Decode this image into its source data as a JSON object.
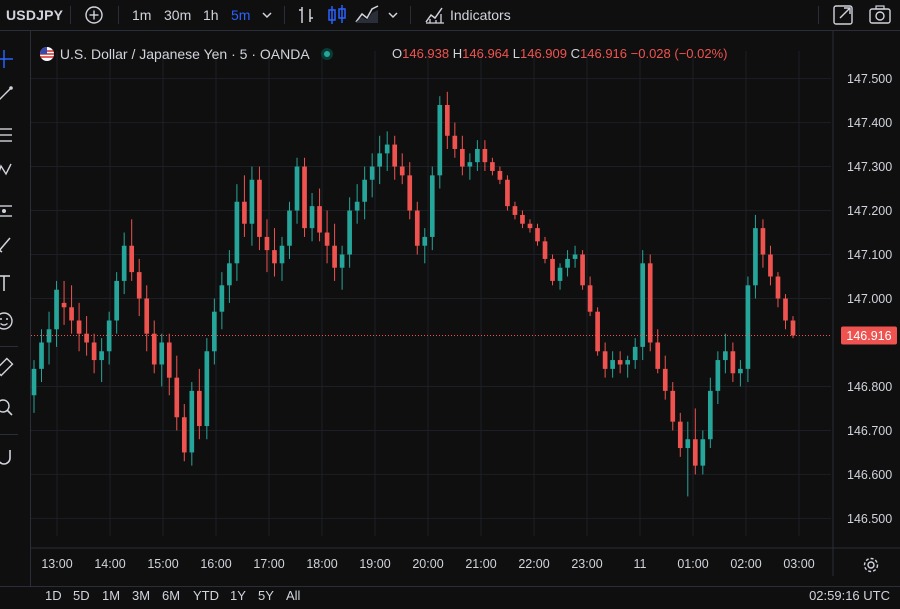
{
  "header": {
    "symbol": "USDJPY",
    "intervals": [
      "1m",
      "30m",
      "1h",
      "5m"
    ],
    "active_interval": "5m",
    "indicators_label": "Indicators"
  },
  "legend": {
    "pair": "U.S. Dollar / Japanese Yen · 5 · OANDA",
    "o_key": "O",
    "o_val": "146.938",
    "h_key": "H",
    "h_val": "146.964",
    "l_key": "L",
    "l_val": "146.909",
    "c_key": "C",
    "c_val": "146.916",
    "change": "−0.028 (−0.02%)"
  },
  "colors": {
    "up": "#26a69a",
    "down": "#ef5350",
    "background": "#0f0f0f",
    "active": "#2962ff"
  },
  "bottom": {
    "ranges": [
      "1D",
      "5D",
      "1M",
      "3M",
      "6M",
      "YTD",
      "1Y",
      "5Y",
      "All"
    ],
    "clock": "02:59:16 UTC"
  },
  "chart_data": {
    "type": "candlestick",
    "last_price": 146.916,
    "last_price_label": "146.916",
    "y_ticks": [
      "147.500",
      "147.400",
      "147.300",
      "147.200",
      "147.100",
      "147.000",
      "146.800",
      "146.700",
      "146.600",
      "146.500"
    ],
    "ylim": [
      146.46,
      147.54
    ],
    "x_ticks": [
      "13:00",
      "14:00",
      "15:00",
      "16:00",
      "17:00",
      "18:00",
      "19:00",
      "20:00",
      "21:00",
      "22:00",
      "23:00",
      "11",
      "01:00",
      "02:00",
      "03:00"
    ],
    "candles": [
      [
        146.78,
        146.86,
        146.74,
        146.84
      ],
      [
        146.84,
        146.93,
        146.81,
        146.9
      ],
      [
        146.9,
        146.97,
        146.85,
        146.93
      ],
      [
        146.93,
        147.04,
        146.89,
        147.02
      ],
      [
        146.99,
        147.04,
        146.94,
        146.98
      ],
      [
        146.98,
        147.03,
        146.92,
        146.95
      ],
      [
        146.95,
        146.99,
        146.88,
        146.92
      ],
      [
        146.92,
        146.96,
        146.87,
        146.9
      ],
      [
        146.9,
        146.92,
        146.83,
        146.86
      ],
      [
        146.86,
        146.91,
        146.81,
        146.88
      ],
      [
        146.88,
        146.97,
        146.85,
        146.95
      ],
      [
        146.95,
        147.06,
        146.92,
        147.04
      ],
      [
        147.04,
        147.15,
        147.01,
        147.12
      ],
      [
        147.12,
        147.18,
        147.04,
        147.06
      ],
      [
        147.06,
        147.09,
        146.96,
        147.0
      ],
      [
        147.0,
        147.03,
        146.88,
        146.92
      ],
      [
        146.92,
        146.95,
        146.83,
        146.85
      ],
      [
        146.85,
        146.92,
        146.8,
        146.9
      ],
      [
        146.9,
        146.92,
        146.78,
        146.82
      ],
      [
        146.82,
        146.87,
        146.7,
        146.73
      ],
      [
        146.73,
        146.76,
        146.63,
        146.65
      ],
      [
        146.65,
        146.81,
        146.62,
        146.79
      ],
      [
        146.79,
        146.84,
        146.68,
        146.71
      ],
      [
        146.71,
        146.91,
        146.68,
        146.88
      ],
      [
        146.88,
        147.0,
        146.85,
        146.97
      ],
      [
        146.97,
        147.06,
        146.93,
        147.03
      ],
      [
        147.03,
        147.11,
        146.99,
        147.08
      ],
      [
        147.08,
        147.26,
        147.04,
        147.22
      ],
      [
        147.22,
        147.28,
        147.14,
        147.17
      ],
      [
        147.17,
        147.3,
        147.12,
        147.27
      ],
      [
        147.27,
        147.3,
        147.11,
        147.14
      ],
      [
        147.14,
        147.18,
        147.06,
        147.11
      ],
      [
        147.11,
        147.16,
        147.05,
        147.08
      ],
      [
        147.08,
        147.14,
        147.04,
        147.12
      ],
      [
        147.12,
        147.22,
        147.09,
        147.2
      ],
      [
        147.2,
        147.32,
        147.17,
        147.3
      ],
      [
        147.3,
        147.32,
        147.14,
        147.16
      ],
      [
        147.16,
        147.24,
        147.13,
        147.21
      ],
      [
        147.21,
        147.25,
        147.13,
        147.15
      ],
      [
        147.15,
        147.2,
        147.08,
        147.12
      ],
      [
        147.12,
        147.17,
        147.04,
        147.07
      ],
      [
        147.07,
        147.12,
        147.02,
        147.1
      ],
      [
        147.1,
        147.23,
        147.07,
        147.2
      ],
      [
        147.2,
        147.26,
        147.17,
        147.22
      ],
      [
        147.22,
        147.3,
        147.18,
        147.27
      ],
      [
        147.27,
        147.33,
        147.23,
        147.3
      ],
      [
        147.3,
        147.37,
        147.26,
        147.33
      ],
      [
        147.33,
        147.38,
        147.29,
        147.35
      ],
      [
        147.35,
        147.37,
        147.27,
        147.3
      ],
      [
        147.3,
        147.33,
        147.26,
        147.28
      ],
      [
        147.28,
        147.31,
        147.18,
        147.2
      ],
      [
        147.2,
        147.22,
        147.1,
        147.12
      ],
      [
        147.12,
        147.16,
        147.08,
        147.14
      ],
      [
        147.14,
        147.3,
        147.11,
        147.28
      ],
      [
        147.28,
        147.46,
        147.25,
        147.44
      ],
      [
        147.44,
        147.47,
        147.34,
        147.37
      ],
      [
        147.37,
        147.4,
        147.32,
        147.34
      ],
      [
        147.34,
        147.37,
        147.28,
        147.3
      ],
      [
        147.3,
        147.33,
        147.27,
        147.31
      ],
      [
        147.31,
        147.36,
        147.29,
        147.34
      ],
      [
        147.34,
        147.36,
        147.29,
        147.31
      ],
      [
        147.31,
        147.32,
        147.28,
        147.29
      ],
      [
        147.29,
        147.3,
        147.26,
        147.27
      ],
      [
        147.27,
        147.28,
        147.2,
        147.21
      ],
      [
        147.21,
        147.22,
        147.18,
        147.19
      ],
      [
        147.19,
        147.2,
        147.16,
        147.17
      ],
      [
        147.17,
        147.18,
        147.15,
        147.16
      ],
      [
        147.16,
        147.17,
        147.12,
        147.13
      ],
      [
        147.13,
        147.14,
        147.08,
        147.09
      ],
      [
        147.09,
        147.1,
        147.03,
        147.04
      ],
      [
        147.04,
        147.08,
        147.02,
        147.07
      ],
      [
        147.07,
        147.11,
        147.05,
        147.09
      ],
      [
        147.09,
        147.12,
        147.07,
        147.1
      ],
      [
        147.1,
        147.11,
        147.02,
        147.03
      ],
      [
        147.03,
        147.05,
        146.96,
        146.97
      ],
      [
        146.97,
        146.98,
        146.87,
        146.88
      ],
      [
        146.88,
        146.9,
        146.82,
        146.84
      ],
      [
        146.84,
        146.88,
        146.82,
        146.86
      ],
      [
        146.86,
        146.88,
        146.83,
        146.85
      ],
      [
        146.85,
        146.87,
        146.82,
        146.86
      ],
      [
        146.86,
        146.91,
        146.84,
        146.89
      ],
      [
        146.89,
        147.11,
        146.86,
        147.08
      ],
      [
        147.08,
        147.1,
        146.88,
        146.9
      ],
      [
        146.9,
        146.93,
        146.83,
        146.84
      ],
      [
        146.84,
        146.87,
        146.77,
        146.79
      ],
      [
        146.79,
        146.81,
        146.7,
        146.72
      ],
      [
        146.72,
        146.74,
        146.64,
        146.66
      ],
      [
        146.66,
        146.72,
        146.55,
        146.68
      ],
      [
        146.68,
        146.75,
        146.6,
        146.62
      ],
      [
        146.62,
        146.7,
        146.6,
        146.68
      ],
      [
        146.68,
        146.82,
        146.66,
        146.79
      ],
      [
        146.79,
        146.88,
        146.76,
        146.86
      ],
      [
        146.86,
        146.92,
        146.83,
        146.88
      ],
      [
        146.88,
        146.9,
        146.81,
        146.83
      ],
      [
        146.83,
        146.86,
        146.8,
        146.84
      ],
      [
        146.84,
        147.05,
        146.81,
        147.03
      ],
      [
        147.03,
        147.19,
        147.0,
        147.16
      ],
      [
        147.16,
        147.18,
        147.07,
        147.1
      ],
      [
        147.1,
        147.12,
        147.03,
        147.05
      ],
      [
        147.05,
        147.06,
        146.98,
        147.0
      ],
      [
        147.0,
        147.01,
        146.93,
        146.95
      ],
      [
        146.95,
        146.96,
        146.91,
        146.916
      ]
    ]
  }
}
